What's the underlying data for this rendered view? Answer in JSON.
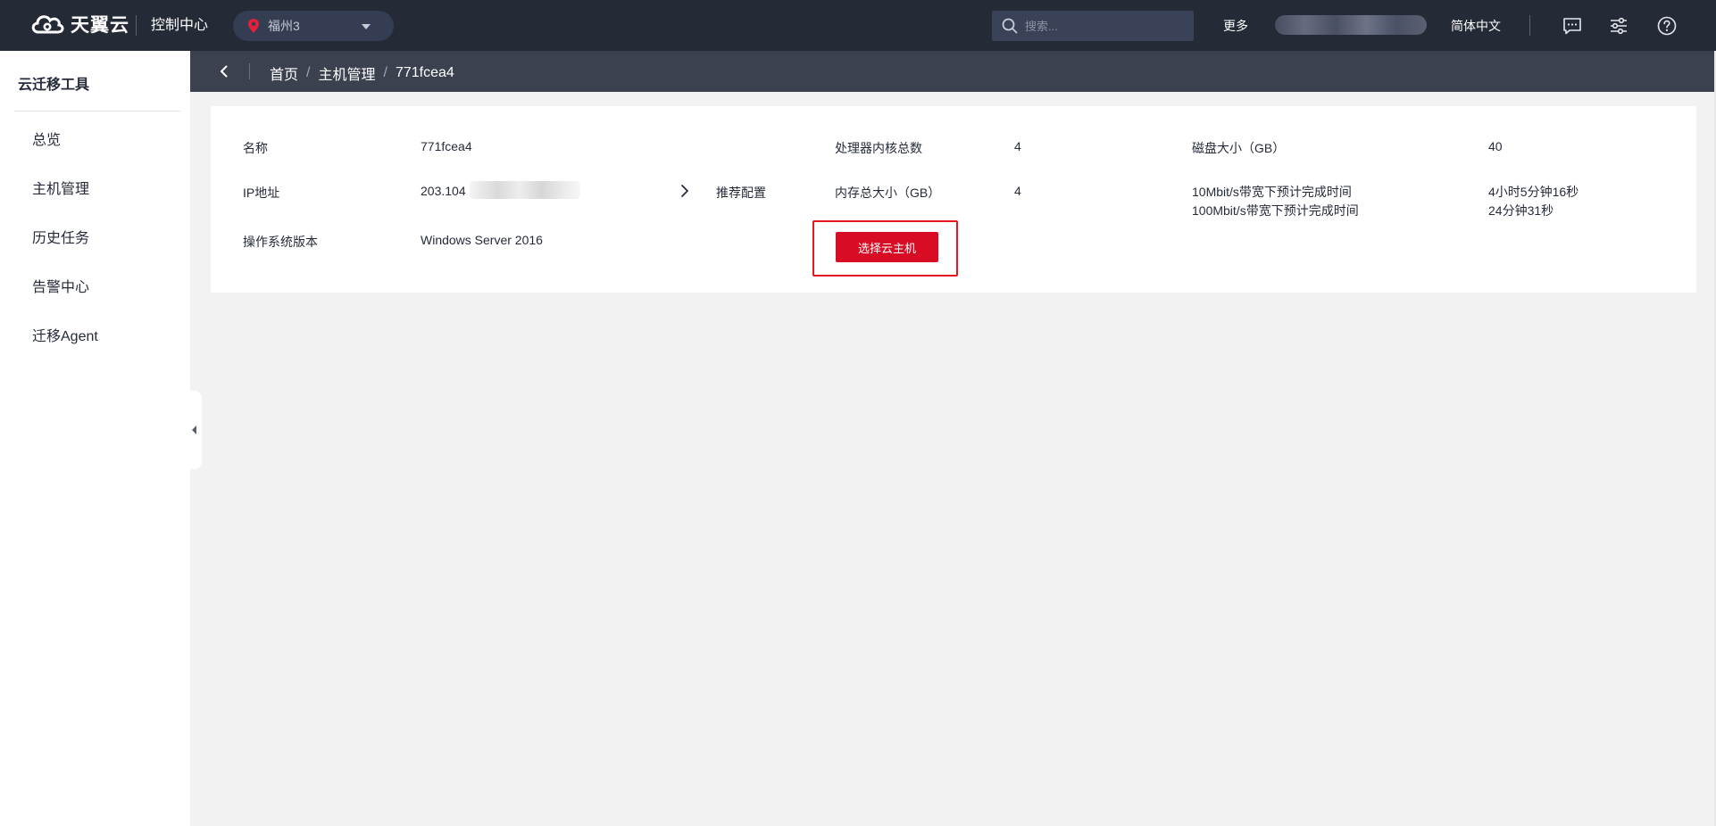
{
  "topbar": {
    "logo_text": "天翼云",
    "console_label": "控制中心",
    "region_label": "福州3",
    "search_placeholder": "搜索...",
    "more_label": "更多",
    "language_label": "简体中文",
    "icons": [
      "message-icon",
      "settings-sliders-icon",
      "help-icon"
    ]
  },
  "sidebar": {
    "title": "云迁移工具",
    "items": [
      {
        "label": "总览"
      },
      {
        "label": "主机管理"
      },
      {
        "label": "历史任务"
      },
      {
        "label": "告警中心"
      },
      {
        "label": "迁移Agent"
      }
    ]
  },
  "breadcrumb": {
    "items": [
      "首页",
      "主机管理",
      "771fcea4"
    ],
    "separator": "/"
  },
  "host_info": {
    "name_label": "名称",
    "name_value": "771fcea4",
    "ip_label": "IP地址",
    "ip_value": "203.104",
    "os_label": "操作系统版本",
    "os_value": "Windows Server 2016",
    "recommend_label": "推荐配置",
    "cpu_label": "处理器内核总数",
    "cpu_value": "4",
    "memory_label": "内存总大小（GB）",
    "memory_value": "4",
    "disk_label": "磁盘大小（GB）",
    "disk_value": "40",
    "bw10_label": "10Mbit/s带宽下预计完成时间",
    "bw10_value": "4小时5分钟16秒",
    "bw100_label": "100Mbit/s带宽下预计完成时间",
    "bw100_value": "24分钟31秒",
    "select_button_label": "选择云主机"
  },
  "colors": {
    "topbar_bg": "#252a37",
    "crumbbar_bg": "#3c4150",
    "primary_button": "#d80c24",
    "highlight_border": "#e9151d",
    "page_bg": "#f2f2f2"
  }
}
